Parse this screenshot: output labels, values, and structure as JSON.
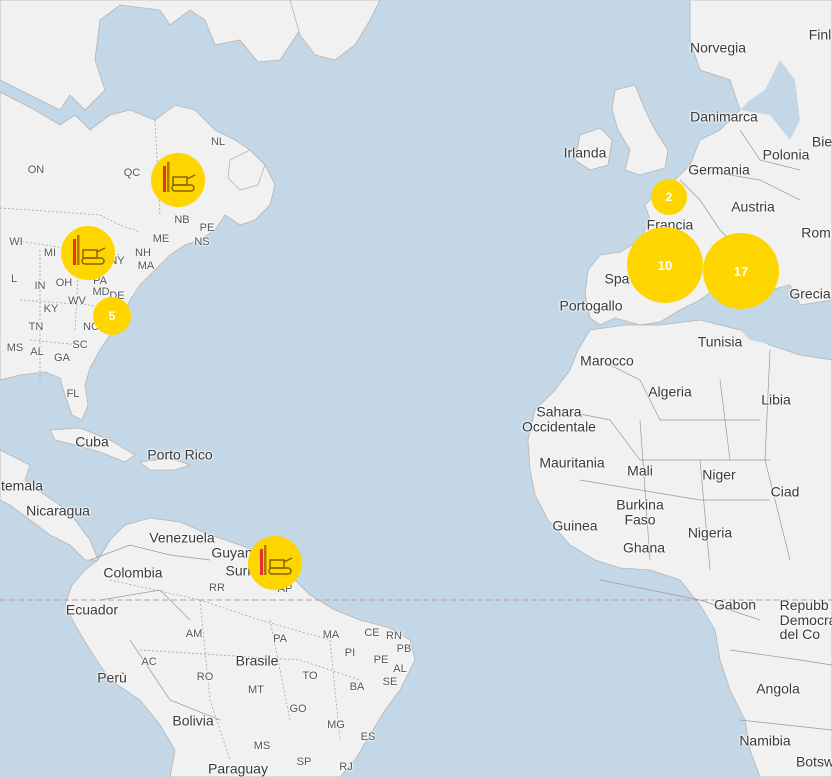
{
  "colors": {
    "water": "#c3d7e6",
    "land": "#f1f1f1",
    "border": "#9a9a9a",
    "cluster": "#ffd500",
    "equator": "#c79a9a"
  },
  "labels": {
    "norvegia": "Norvegia",
    "finl": "Finl",
    "danimarca": "Danimarca",
    "irlanda": "Irlanda",
    "germania": "Germania",
    "polonia": "Polonia",
    "bie": "Bie",
    "austria": "Austria",
    "rom": "Rom",
    "francia": "Francia",
    "grecia": "Grecia",
    "spa": "Spa",
    "portogallo": "Portogallo",
    "tunisia": "Tunisia",
    "marocco": "Marocco",
    "algeria": "Algeria",
    "libia": "Libia",
    "sahara": "Sahara\nOccidentale",
    "mauritania": "Mauritania",
    "mali": "Mali",
    "niger": "Niger",
    "ciad": "Ciad",
    "burkina": "Burkina\nFaso",
    "guinea": "Guinea",
    "ghana": "Ghana",
    "nigeria": "Nigeria",
    "gabon": "Gabon",
    "repubb": "Repubb\nDemocra\ndel Co",
    "angola": "Angola",
    "namibia": "Namibia",
    "botsw": "Botsw",
    "cuba": "Cuba",
    "portorico": "Porto Rico",
    "temala": "temala",
    "nicaragua": "Nicaragua",
    "venezuela": "Venezuela",
    "guyana": "Guyan",
    "suri": "Suri",
    "colombia": "Colombia",
    "ecuador": "Ecuador",
    "peru": "Perù",
    "brasile": "Brasile",
    "bolivia": "Bolivia",
    "paraguay": "Paraguay"
  },
  "state_labels": {
    "on": "ON",
    "qc": "QC",
    "nl": "NL",
    "nb": "NB",
    "pe": "PE",
    "ns": "NS",
    "wi": "WI",
    "mi": "MI",
    "me": "ME",
    "nh": "NH",
    "ma": "MA",
    "ny": "NY",
    "l": "L",
    "in": "IN",
    "oh": "OH",
    "pa": "PA",
    "md": "MD",
    "de": "DE",
    "ky": "KY",
    "wv": "WV",
    "tn": "TN",
    "nc": "NC",
    "ms": "MS",
    "al": "AL",
    "ga": "GA",
    "sc": "SC",
    "fl": "FL",
    "rr": "RR",
    "ap": "AP",
    "am": "AM",
    "pa_br": "PA",
    "ma_br": "MA",
    "ce": "CE",
    "rn": "RN",
    "pb": "PB",
    "pi": "PI",
    "pe_br": "PE",
    "ac": "AC",
    "to": "TO",
    "al_br": "AL",
    "se": "SE",
    "ro": "RO",
    "ba": "BA",
    "mt": "MT",
    "go": "GO",
    "mg": "MG",
    "ms_br": "MS",
    "es": "ES",
    "sp": "SP",
    "rj": "RJ"
  },
  "clusters": {
    "france": "2",
    "spain": "10",
    "italy": "17",
    "usa_east": "5"
  }
}
